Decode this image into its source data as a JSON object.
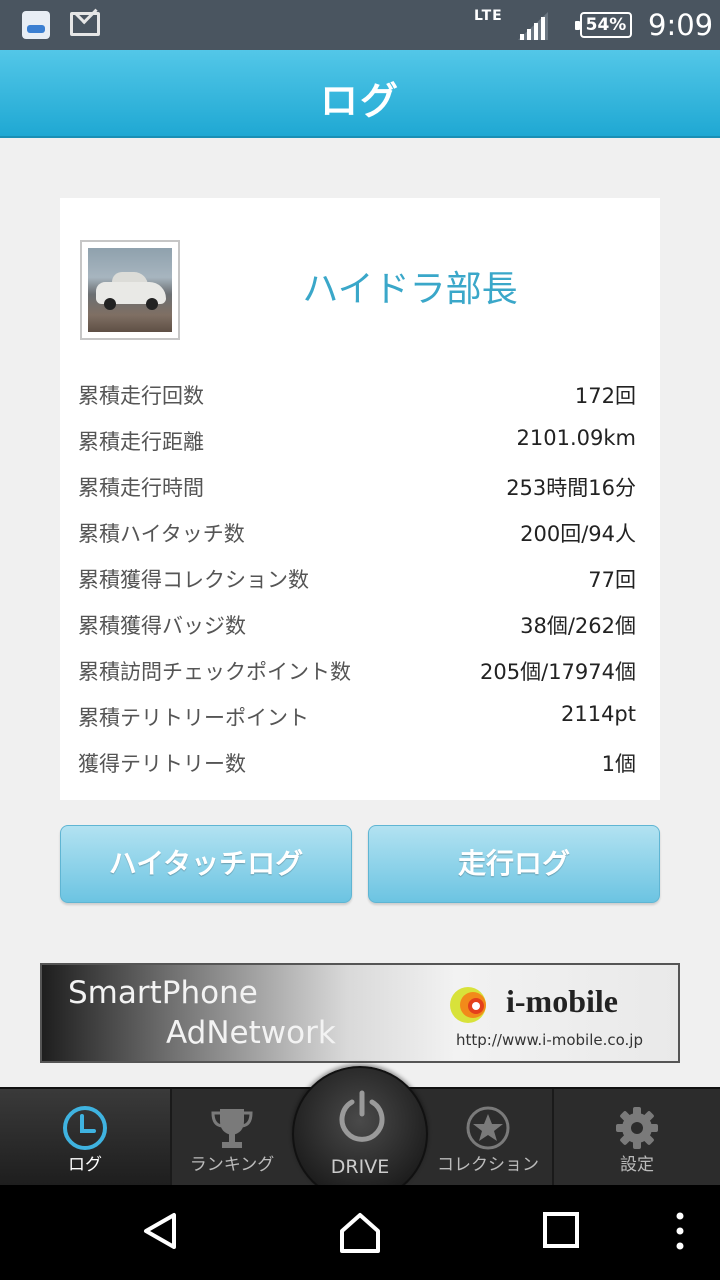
{
  "status_bar": {
    "network": "LTE",
    "battery": "54%",
    "time": "9:09"
  },
  "header": {
    "title": "ログ"
  },
  "profile": {
    "name": "ハイドラ部長"
  },
  "stats": [
    {
      "label": "累積走行回数",
      "value": "172回"
    },
    {
      "label": "累積走行距離",
      "value": "2101.09km"
    },
    {
      "label": "累積走行時間",
      "value": "253時間16分"
    },
    {
      "label": "累積ハイタッチ数",
      "value": "200回/94人"
    },
    {
      "label": "累積獲得コレクション数",
      "value": "77回"
    },
    {
      "label": "累積獲得バッジ数",
      "value": "38個/262個"
    },
    {
      "label": "累積訪問チェックポイント数",
      "value": "205個/17974個"
    },
    {
      "label": "累積テリトリーポイント",
      "value": "2114pt"
    },
    {
      "label": "獲得テリトリー数",
      "value": "1個"
    }
  ],
  "buttons": {
    "hightouch_log": "ハイタッチログ",
    "drive_log": "走行ログ"
  },
  "ad": {
    "line1": "SmartPhone",
    "line2": "AdNetwork",
    "brand": "i-mobile",
    "url": "http://www.i-mobile.co.jp"
  },
  "tabs": {
    "log": "ログ",
    "ranking": "ランキング",
    "drive": "DRIVE",
    "collection": "コレクション",
    "settings": "設定"
  },
  "colors": {
    "accent": "#1fa8d3",
    "name": "#3aa7c9",
    "button": "#6cc4e2"
  }
}
